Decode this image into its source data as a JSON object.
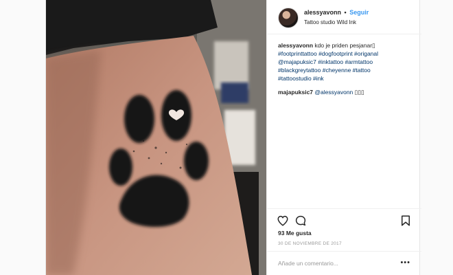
{
  "header": {
    "username": "alessyavonn",
    "separator": "•",
    "follow_label": "Seguir",
    "location": "Tattoo studio Wild Ink"
  },
  "caption": {
    "username": "alessyavonn",
    "text": "kdo je priden pesjanar▯",
    "hashtags_line1": "#footprinttattoo #dogfootprint #origanal",
    "hashtags_line2": "@majapuksic7 #inktattoo #armtattoo",
    "hashtags_line3": "#blackgreytattoo #cheyenne #tattoo",
    "hashtags_line4": "#tattoostudio #ink"
  },
  "comment": {
    "username": "majapuksic7",
    "mention": "@alessyavonn",
    "text": "▯▯▯"
  },
  "actions": {
    "likes": "93 Me gusta",
    "date": "30 DE NOVIEMBRE DE 2017",
    "add_comment_placeholder": "Añade un comentario...",
    "more_label": "•••"
  },
  "icons": [
    "heart-icon",
    "comment-icon",
    "bookmark-icon",
    "more-options-icon"
  ],
  "colors": {
    "link": "#3897f0",
    "hashtag": "#003569",
    "muted": "#999999"
  }
}
